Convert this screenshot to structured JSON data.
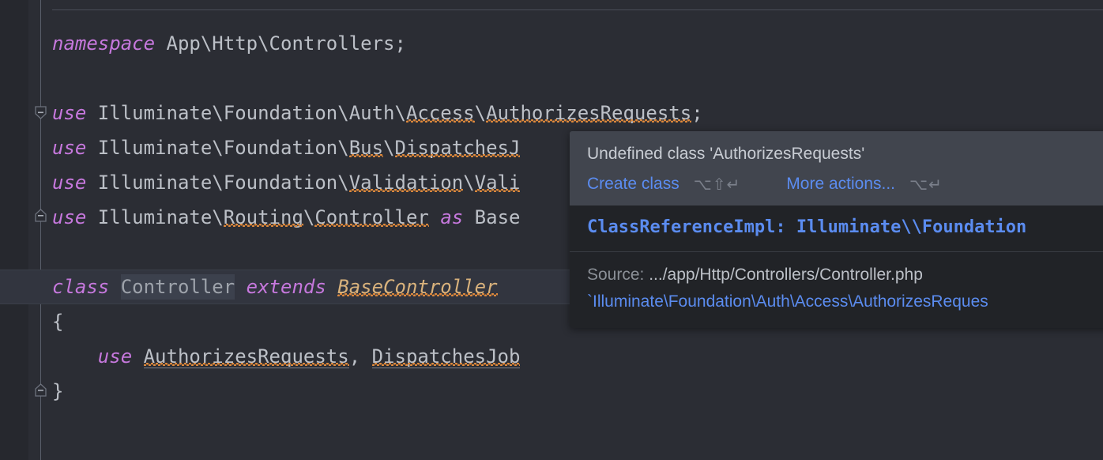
{
  "editor": {
    "language": "php",
    "background": "#2b2d34",
    "gutter_background": "#26282e",
    "caret_line_background": "#32353f",
    "lines": [
      {
        "n": 1,
        "indent": 0,
        "tokens": []
      },
      {
        "n": 2,
        "indent": 0,
        "tokens": [
          {
            "t": "namespace",
            "k": "kw"
          },
          {
            "t": " App\\Http\\Controllers;",
            "k": "id"
          }
        ]
      },
      {
        "n": 3,
        "indent": 0,
        "tokens": []
      },
      {
        "n": 4,
        "indent": 0,
        "tokens": [
          {
            "t": "use",
            "k": "kw"
          },
          {
            "t": " Illuminate\\Foundation\\Auth\\",
            "k": "id"
          },
          {
            "t": "Access",
            "k": "id",
            "squiggle": true
          },
          {
            "t": "\\",
            "k": "id"
          },
          {
            "t": "AuthorizesRequests",
            "k": "id",
            "squiggle": true
          },
          {
            "t": ";",
            "k": "id"
          }
        ]
      },
      {
        "n": 5,
        "indent": 0,
        "tokens": [
          {
            "t": "use",
            "k": "kw"
          },
          {
            "t": " Illuminate\\Foundation\\",
            "k": "id"
          },
          {
            "t": "Bus",
            "k": "id",
            "squiggle": true
          },
          {
            "t": "\\",
            "k": "id"
          },
          {
            "t": "DispatchesJ",
            "k": "id",
            "squiggle": true
          }
        ]
      },
      {
        "n": 6,
        "indent": 0,
        "tokens": [
          {
            "t": "use",
            "k": "kw"
          },
          {
            "t": " Illuminate\\Foundation\\",
            "k": "id"
          },
          {
            "t": "Validation",
            "k": "id",
            "squiggle": true
          },
          {
            "t": "\\",
            "k": "id"
          },
          {
            "t": "Vali",
            "k": "id",
            "squiggle": true
          }
        ]
      },
      {
        "n": 7,
        "indent": 0,
        "tokens": [
          {
            "t": "use",
            "k": "kw"
          },
          {
            "t": " Illuminate\\",
            "k": "id"
          },
          {
            "t": "Routing",
            "k": "id",
            "squiggle": true
          },
          {
            "t": "\\",
            "k": "id"
          },
          {
            "t": "Controller",
            "k": "id",
            "squiggle": true
          },
          {
            "t": " ",
            "k": "id"
          },
          {
            "t": "as",
            "k": "kw"
          },
          {
            "t": " Base",
            "k": "id"
          }
        ]
      },
      {
        "n": 8,
        "indent": 0,
        "tokens": []
      },
      {
        "n": 9,
        "indent": 0,
        "caret": true,
        "tokens": [
          {
            "t": "class",
            "k": "kw"
          },
          {
            "t": " ",
            "k": "id"
          },
          {
            "t": "Controller",
            "k": "hl"
          },
          {
            "t": " ",
            "k": "id"
          },
          {
            "t": "extends",
            "k": "kw"
          },
          {
            "t": " ",
            "k": "id"
          },
          {
            "t": "BaseController",
            "k": "cls",
            "squiggle": true
          }
        ]
      },
      {
        "n": 10,
        "indent": 0,
        "tokens": [
          {
            "t": "{",
            "k": "id"
          }
        ]
      },
      {
        "n": 11,
        "indent": 0,
        "tokens": [
          {
            "t": "    ",
            "k": "id"
          },
          {
            "t": "use",
            "k": "kw"
          },
          {
            "t": " ",
            "k": "id"
          },
          {
            "t": "AuthorizesRequests",
            "k": "id",
            "squiggle": true,
            "underline": true
          },
          {
            "t": ", ",
            "k": "id"
          },
          {
            "t": "DispatchesJob",
            "k": "id",
            "squiggle": true,
            "underline": true
          }
        ]
      },
      {
        "n": 12,
        "indent": 0,
        "tokens": [
          {
            "t": "}",
            "k": "id"
          }
        ]
      }
    ],
    "fold_markers": [
      {
        "line": 4,
        "type": "expanded-open"
      },
      {
        "line": 7,
        "type": "expanded-close"
      },
      {
        "line": 9,
        "type": "expanded-open"
      },
      {
        "line": 12,
        "type": "expanded-close"
      }
    ],
    "intention_bulb": {
      "line": 8,
      "icon": "lightbulb-icon",
      "color": "#f2d544"
    }
  },
  "tooltip": {
    "title": "Undefined class 'AuthorizesRequests'",
    "actions": [
      {
        "label": "Create class",
        "shortcut": "⌥⇧↵"
      },
      {
        "label": "More actions...",
        "shortcut": "⌥↵"
      }
    ],
    "reference_line": "ClassReferenceImpl: Illuminate\\\\Foundation",
    "source_label": "Source:",
    "source_path": ".../app/Http/Controllers/Controller.php",
    "fqn": "`Illuminate\\Foundation\\Auth\\Access\\AuthorizesReques",
    "colors": {
      "header_bg": "#41454e",
      "body_bg": "#212327",
      "link": "#5b8cf0",
      "title_text": "#c8ccd3",
      "shortcut_text": "#7b808b"
    }
  }
}
